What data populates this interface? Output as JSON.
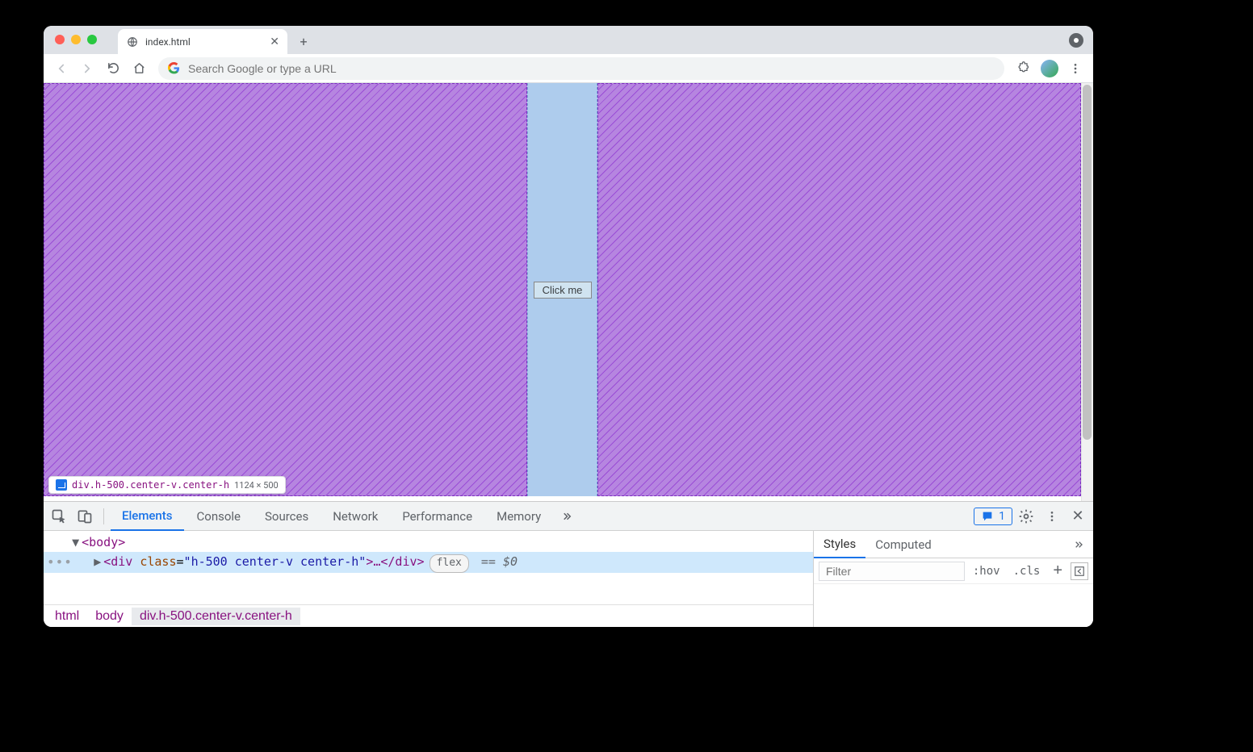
{
  "browser": {
    "tab_title": "index.html",
    "omnibox_placeholder": "Search Google or type a URL"
  },
  "page": {
    "button_label": "Click me",
    "tooltip_selector": "div.h-500.center-v.center-h",
    "tooltip_dims": "1124 × 500"
  },
  "devtools": {
    "tabs": [
      "Elements",
      "Console",
      "Sources",
      "Network",
      "Performance",
      "Memory"
    ],
    "active_tab": "Elements",
    "issues_count": "1",
    "dom": {
      "line1_open": "<body>",
      "line2_tagname": "div",
      "line2_attr_name": "class",
      "line2_attr_val": "h-500 center-v center-h",
      "line2_tail": "…</div>",
      "flex_pill": "flex",
      "eq_selector": "== $0"
    },
    "breadcrumbs": [
      "html",
      "body",
      "div.h-500.center-v.center-h"
    ],
    "styles": {
      "tabs": [
        "Styles",
        "Computed"
      ],
      "filter_placeholder": "Filter",
      "hov": ":hov",
      "cls": ".cls"
    }
  }
}
